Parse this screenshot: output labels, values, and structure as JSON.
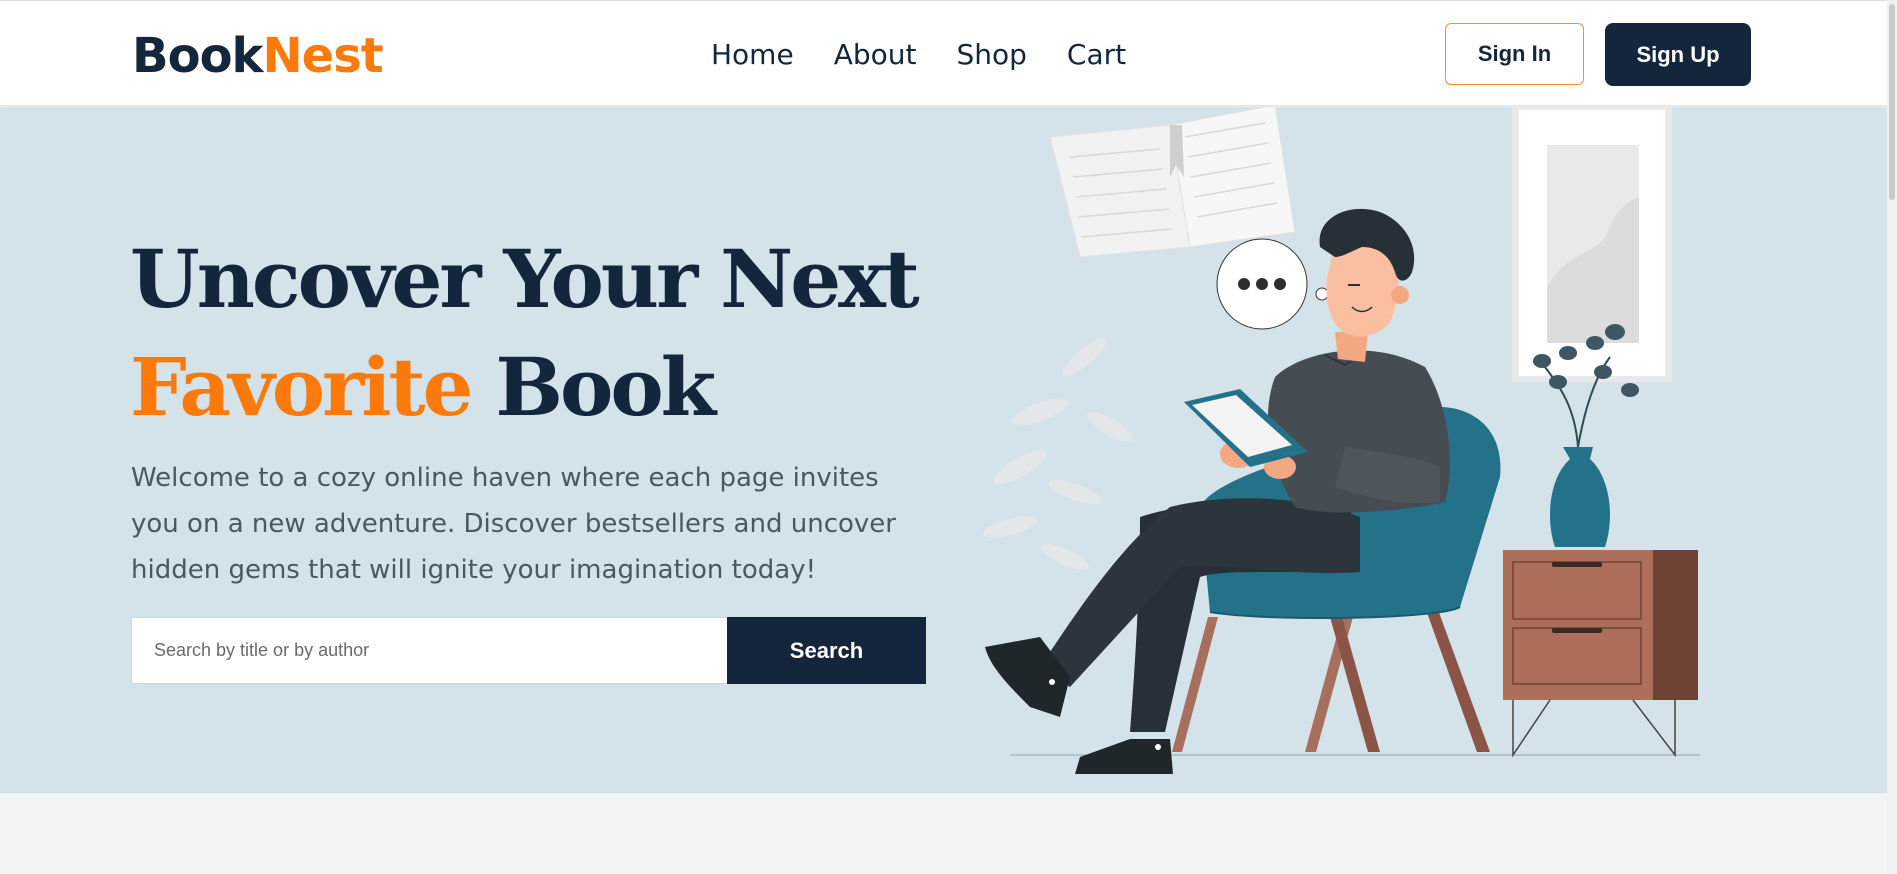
{
  "brand": {
    "part1": "Book",
    "part2": "Nest"
  },
  "nav": {
    "items": [
      "Home",
      "About",
      "Shop",
      "Cart"
    ]
  },
  "auth": {
    "sign_in": "Sign In",
    "sign_up": "Sign Up"
  },
  "hero": {
    "title_line1": "Uncover Your Next",
    "title_accent": "Favorite",
    "title_rest": "Book",
    "lead": "Welcome to a cozy online haven where each page invites you on a new adventure. Discover bestsellers and uncover hidden gems that will ignite your imagination today!"
  },
  "search": {
    "placeholder": "Search by title or by author",
    "value": "",
    "button": "Search"
  },
  "colors": {
    "navy": "#13263b",
    "orange": "#fb7a0b",
    "hero_bg": "#d4e2e9",
    "chair": "#23728a",
    "cabinet": "#ad6f5c"
  },
  "illustration": {
    "icon": "man-reading-in-armchair-illustration"
  }
}
